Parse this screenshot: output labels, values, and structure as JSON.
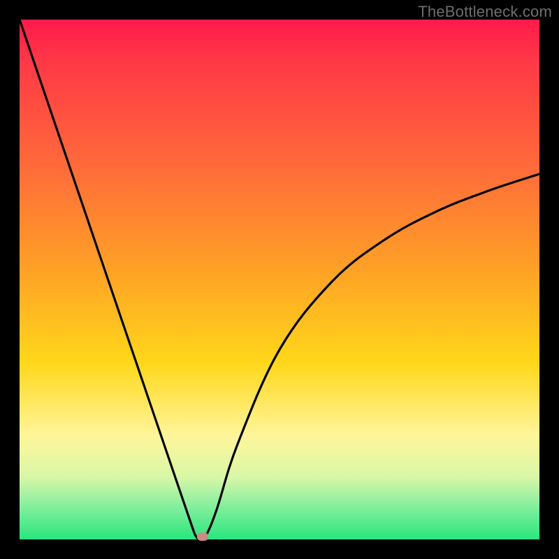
{
  "watermark": "TheBottleneck.com",
  "chart_data": {
    "type": "line",
    "title": "",
    "xlabel": "",
    "ylabel": "",
    "xlim": [
      0,
      100
    ],
    "ylim": [
      0,
      100
    ],
    "grid": false,
    "series": [
      {
        "name": "curve",
        "x": [
          0,
          5,
          10,
          15,
          20,
          25,
          30,
          33,
          34,
          35,
          36,
          38,
          42,
          50,
          60,
          70,
          80,
          90,
          100
        ],
        "y": [
          100,
          85.3,
          70.6,
          55.9,
          41.2,
          26.5,
          11.8,
          3.0,
          0.5,
          0.0,
          1.0,
          6.0,
          18.5,
          36.5,
          49.5,
          57.5,
          63.0,
          67.0,
          70.3
        ]
      }
    ],
    "marker": {
      "x": 35.2,
      "y": 0.5,
      "color": "#cf8a82"
    },
    "band_colors": {
      "top": "#ff1a4b",
      "mid_upper": "#ffa126",
      "mid": "#ffd71a",
      "mid_lower": "#d8f7a6",
      "bottom": "#2ae57e"
    }
  }
}
